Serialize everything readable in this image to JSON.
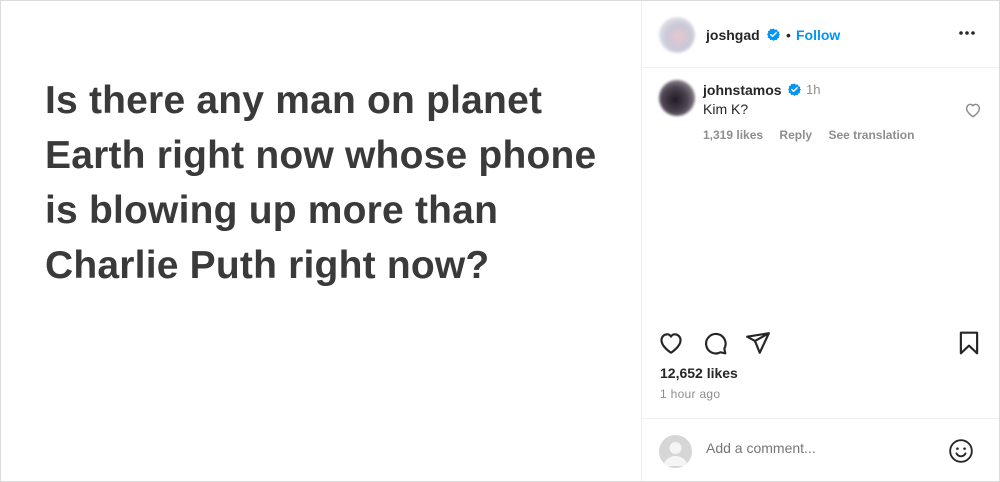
{
  "post": {
    "text": "Is there any man on planet Earth right now whose phone is blowing up more than Charlie Puth right now?"
  },
  "header": {
    "username": "joshgad",
    "separator": "•",
    "follow_label": "Follow"
  },
  "comment": {
    "username": "johnstamos",
    "time": "1h",
    "text": "Kim K?",
    "likes": "1,319 likes",
    "reply_label": "Reply",
    "translate_label": "See translation"
  },
  "stats": {
    "likes": "12,652 likes",
    "time": "1 hour ago"
  },
  "composer": {
    "placeholder": "Add a comment..."
  },
  "colors": {
    "accent": "#0095f6",
    "verified": "#0095f6",
    "muted": "#8e8e8e"
  },
  "icons": [
    "more-options-icon",
    "verified-badge-icon",
    "heart-icon",
    "comment-icon",
    "share-icon",
    "bookmark-icon",
    "emoji-icon"
  ]
}
